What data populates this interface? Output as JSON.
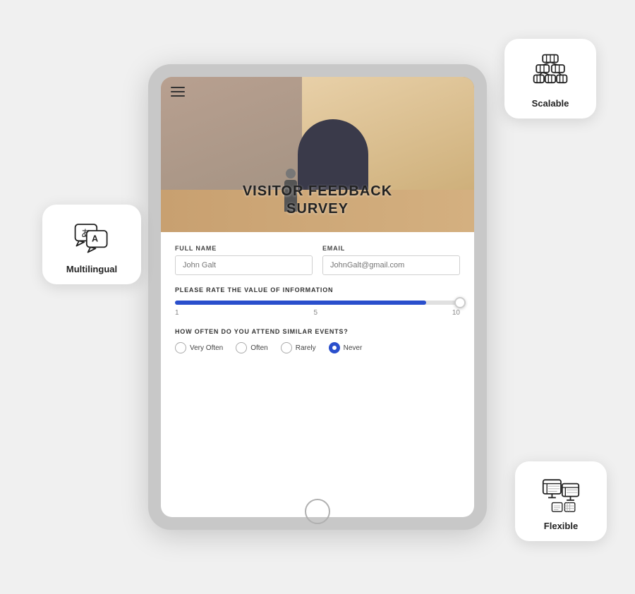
{
  "page": {
    "background": "#f0f0f0"
  },
  "survey": {
    "title_line1": "VISITOR FEEDBACK",
    "title_line2": "SURVEY",
    "fields": {
      "full_name_label": "FULL NAME",
      "full_name_placeholder": "John Galt",
      "email_label": "EMAIL",
      "email_placeholder": "JohnGalt@gmail.com"
    },
    "slider": {
      "label": "PLEASE RATE THE VALUE OF INFORMATION",
      "min": "1",
      "mid": "5",
      "max": "10",
      "fill_percent": 88
    },
    "frequency": {
      "label": "HOW OFTEN DO YOU ATTEND SIMILAR EVENTS?",
      "options": [
        "Very Often",
        "Often",
        "Rarely",
        "Never"
      ],
      "selected": 3
    }
  },
  "badges": {
    "multilingual": {
      "label": "Multilingual"
    },
    "scalable": {
      "label": "Scalable"
    },
    "flexible": {
      "label": "Flexible"
    }
  },
  "hamburger_icon": "≡"
}
